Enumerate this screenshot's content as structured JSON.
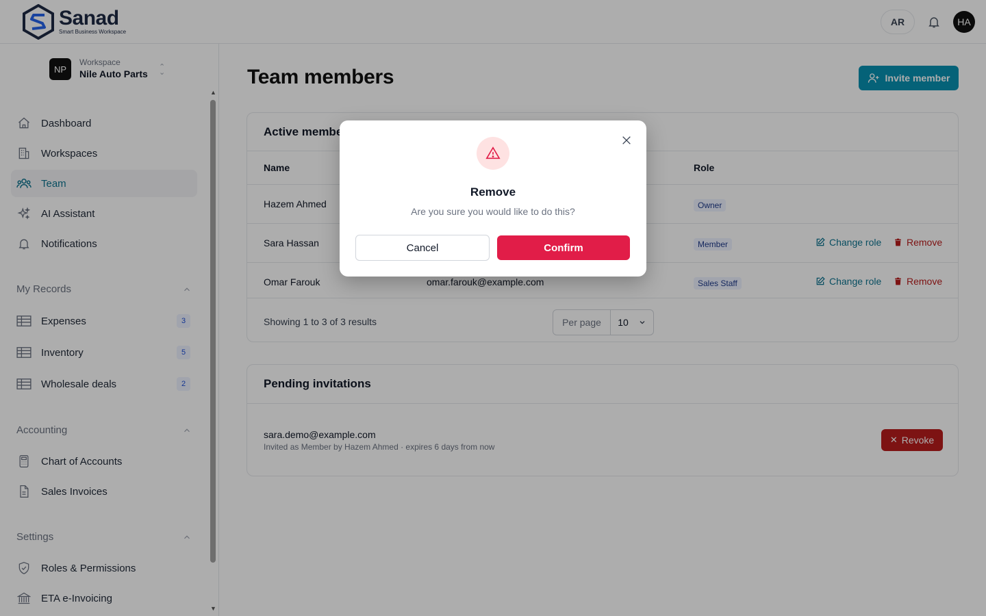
{
  "header": {
    "brand_name": "Sanad",
    "brand_tagline": "Smart Business Workspace",
    "lang_toggle": "AR",
    "user_initials": "HA"
  },
  "workspace": {
    "label": "Workspace",
    "name": "Nile Auto Parts",
    "initials": "NP"
  },
  "sidebar": {
    "main": [
      {
        "label": "Dashboard",
        "icon": "home-icon"
      },
      {
        "label": "Workspaces",
        "icon": "building-icon"
      },
      {
        "label": "Team",
        "icon": "users-icon",
        "active": true
      },
      {
        "label": "AI Assistant",
        "icon": "sparkles-icon"
      },
      {
        "label": "Notifications",
        "icon": "bell-icon"
      }
    ],
    "my_records": {
      "title": "My Records",
      "items": [
        {
          "label": "Expenses",
          "count": "3"
        },
        {
          "label": "Inventory",
          "count": "5"
        },
        {
          "label": "Wholesale deals",
          "count": "2"
        }
      ]
    },
    "accounting": {
      "title": "Accounting",
      "items": [
        {
          "label": "Chart of Accounts"
        },
        {
          "label": "Sales Invoices"
        }
      ]
    },
    "settings": {
      "title": "Settings",
      "items": [
        {
          "label": "Roles & Permissions"
        },
        {
          "label": "ETA e-Invoicing"
        }
      ]
    }
  },
  "main": {
    "title": "Team members",
    "invite_label": "Invite member",
    "active": {
      "title": "Active members",
      "columns": {
        "name": "Name",
        "role": "Role"
      },
      "rows": [
        {
          "name": "Hazem Ahmed",
          "email": "",
          "role": "Owner"
        },
        {
          "name": "Sara Hassan",
          "email": "",
          "role": "Member",
          "change": "Change role",
          "remove": "Remove"
        },
        {
          "name": "Omar Farouk",
          "email": "omar.farouk@example.com",
          "role": "Sales Staff",
          "change": "Change role",
          "remove": "Remove"
        }
      ],
      "showing": "Showing 1 to 3 of 3 results",
      "per_page_label": "Per page",
      "per_page_value": "10"
    },
    "pending": {
      "title": "Pending invitations",
      "email": "sara.demo@example.com",
      "meta": "Invited as Member by Hazem Ahmed · expires 6 days from now",
      "revoke_label": "Revoke"
    }
  },
  "modal": {
    "title": "Remove",
    "description": "Are you sure you would like to do this?",
    "cancel_label": "Cancel",
    "confirm_label": "Confirm"
  },
  "colors": {
    "accent": "#0891b2",
    "danger": "#e11d48",
    "revoke": "#b91c1c"
  }
}
